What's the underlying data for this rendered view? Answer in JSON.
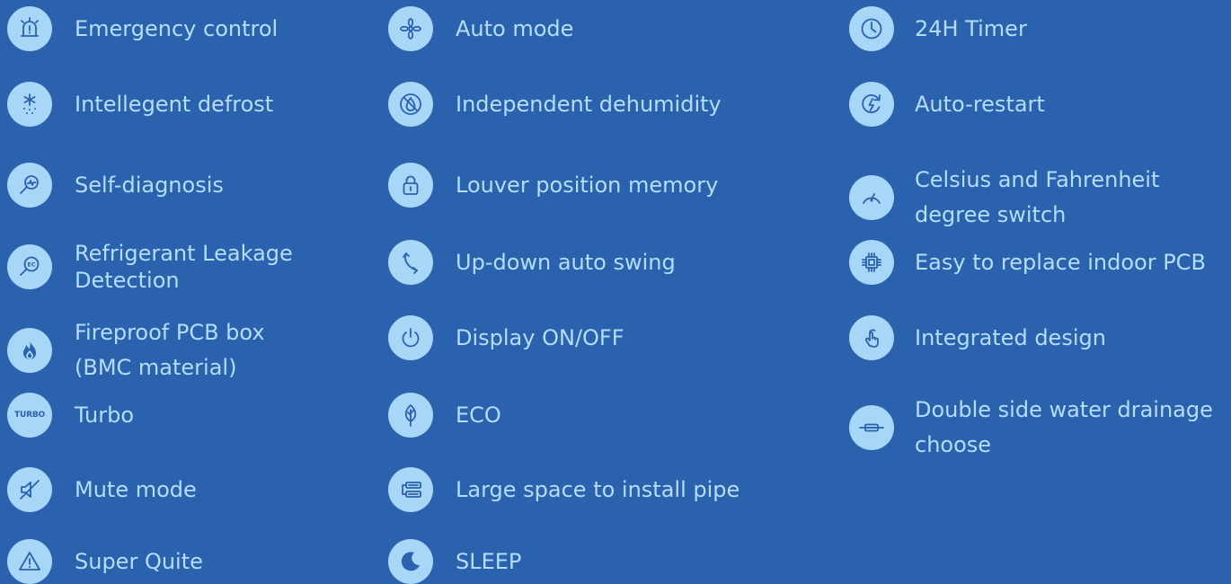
{
  "features": {
    "col1": [
      {
        "label": "Emergency control"
      },
      {
        "label": "Intellegent defrost"
      },
      {
        "label": "Self-diagnosis"
      },
      {
        "line1": "Refrigerant Leakage",
        "line2": "Detection"
      },
      {
        "line1": "Fireproof PCB box",
        "line2": "(BMC material)"
      },
      {
        "label": "Turbo",
        "icon_text": "TURBO"
      },
      {
        "label": "Mute mode"
      },
      {
        "label": "Super Quite"
      }
    ],
    "col2": [
      {
        "label": "Auto mode"
      },
      {
        "label": "Independent dehumidity"
      },
      {
        "label": "Louver position memory"
      },
      {
        "label": "Up-down auto swing"
      },
      {
        "label": "Display ON/OFF"
      },
      {
        "label": "ECO"
      },
      {
        "label": "Large space to install pipe"
      },
      {
        "label": "SLEEP"
      }
    ],
    "col3": [
      {
        "label": "24H Timer"
      },
      {
        "label": "Auto-restart"
      },
      {
        "line1": "Celsius and Fahrenheit",
        "line2": "degree switch"
      },
      {
        "label": "Easy to replace indoor PCB"
      },
      {
        "label": "Integrated design"
      },
      {
        "line1": "Double side water drainage",
        "line2": "choose"
      }
    ]
  },
  "colors": {
    "background": "#2a62ad",
    "icon_fill": "#a7d6f7",
    "text": "#b4ddf8"
  },
  "icons": [
    "siren-icon",
    "snowflake-defrost-icon",
    "diagnosis-magnifier-icon",
    "leak-detection-icon",
    "flame-icon",
    "turbo-icon",
    "mute-icon",
    "warning-triangle-icon",
    "fan-icon",
    "no-drop-icon",
    "padlock-icon",
    "swing-arrow-icon",
    "power-icon",
    "leaf-icon",
    "pipe-unit-icon",
    "moon-icon",
    "clock-icon",
    "restart-lightning-icon",
    "gauge-icon",
    "chip-icon",
    "hand-touch-icon",
    "drainage-unit-icon"
  ]
}
